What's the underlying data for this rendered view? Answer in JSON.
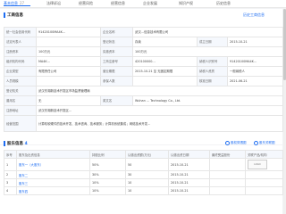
{
  "tabs": [
    {
      "label": "基本信息",
      "count": "27",
      "active": true
    },
    {
      "label": "法律诉讼",
      "count": ""
    },
    {
      "label": "经营风险",
      "count": ""
    },
    {
      "label": "经营信息",
      "count": ""
    },
    {
      "label": "企业发展",
      "count": ""
    },
    {
      "label": "知识产权",
      "count": ""
    },
    {
      "label": "历史信息",
      "count": ""
    }
  ],
  "business": {
    "title": "工商信息",
    "history_link": "历史工商信息",
    "rows": [
      [
        "统一社会信用代码",
        "91420100MA4K...",
        "企业名称",
        "武汉…信息技术有限公司",
        "",
        ""
      ],
      [
        "法定代表人",
        "",
        "登记状态",
        "存续",
        "成立日期",
        "2015-10-21"
      ],
      [
        "注册资本",
        "100万元",
        "实缴资本",
        "100万元",
        "",
        ""
      ],
      [
        "组织机构代码",
        "MA4K...",
        "工商注册号",
        "420100000...",
        "纳税人识别号",
        "91420100MA4K..."
      ],
      [
        "企业类型",
        "有限责任公司",
        "营业期限",
        "2015-10-21 至 无固定期限",
        "纳税人资质",
        "一般纳税人"
      ],
      [
        "人员规模",
        "",
        "参保人数",
        "",
        "核准日期",
        "2021-06-21"
      ],
      [
        "登记机关",
        "武汉东湖新技术开发区市场监督管理局",
        "",
        "",
        "",
        ""
      ],
      [
        "曾用名",
        "无",
        "英文名",
        "Wuhan ... Technology Co., Ltd.",
        "",
        ""
      ],
      [
        "注册地址",
        "武汉东湖新技术开发区...",
        "",
        "",
        "",
        ""
      ],
      [
        "经营范围",
        "计算机软硬件的技术开发、技术咨询、技术服务；计算机系统集成；网络技术开发…",
        "",
        "",
        "",
        ""
      ]
    ],
    "tags": {
      "register": "变更",
      "legal_tag": "他关联"
    }
  },
  "members": {
    "title": "股东信息",
    "count": "4",
    "btn1": "股权穿透图",
    "btn2": "股东关联图",
    "columns": [
      "序号",
      "股东及出资信息",
      "持股比例",
      "认缴出资额(万元)",
      "认缴出资日期",
      "最终受益股份",
      "关联产品/机构"
    ],
    "rows": [
      {
        "index": "1",
        "name": "股东一（大股东）",
        "ratio": "50%",
        "amount": "50",
        "date": "2015-10-21",
        "benefit": "",
        "logo": "LOGO"
      },
      {
        "index": "2",
        "name": "股东二",
        "ratio": "30%",
        "amount": "30",
        "date": "2015-10-21",
        "benefit": "",
        "logo": ""
      },
      {
        "index": "3",
        "name": "股东三",
        "ratio": "10%",
        "amount": "10",
        "date": "2015-10-21",
        "benefit": "",
        "logo": ""
      },
      {
        "index": "4",
        "name": "股东四",
        "ratio": "10%",
        "amount": "10",
        "date": "2015-10-21",
        "benefit": "",
        "logo": ""
      }
    ]
  }
}
